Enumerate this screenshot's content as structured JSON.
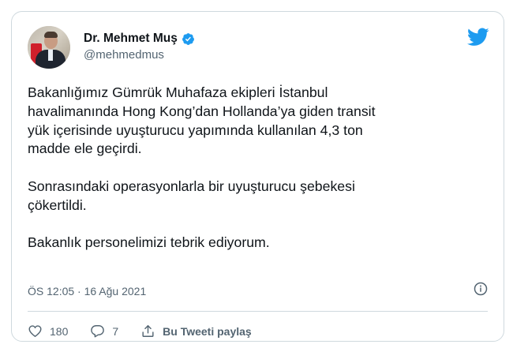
{
  "tweet": {
    "author_name": "Dr. Mehmet Muş",
    "handle": "@mehmedmus",
    "body": "Bakanlığımız Gümrük Muhafaza ekipleri İstanbul\nhavalimanında Hong Kong’dan Hollanda’ya giden transit\nyük içerisinde uyuşturucu yapımında kullanılan 4,3 ton\nmadde ele geçirdi.\n\nSonrasındaki operasyonlarla bir uyuşturucu şebekesi\nçökertildi.\n\nBakanlık personelimizi tebrik ediyorum.",
    "timestamp": "ÖS 12:05 · 16 Ağu 2021",
    "likes": "180",
    "replies": "7",
    "share_label": "Bu Tweeti paylaş"
  },
  "icons": {
    "verified": "verified-badge-icon",
    "brand": "twitter-bird-icon",
    "info": "info-icon",
    "like": "heart-icon",
    "reply": "reply-bubble-icon",
    "share": "share-icon"
  },
  "colors": {
    "brand_blue": "#1d9bf0",
    "text_primary": "#0f1419",
    "text_secondary": "#536471",
    "border": "#cfd9de"
  }
}
